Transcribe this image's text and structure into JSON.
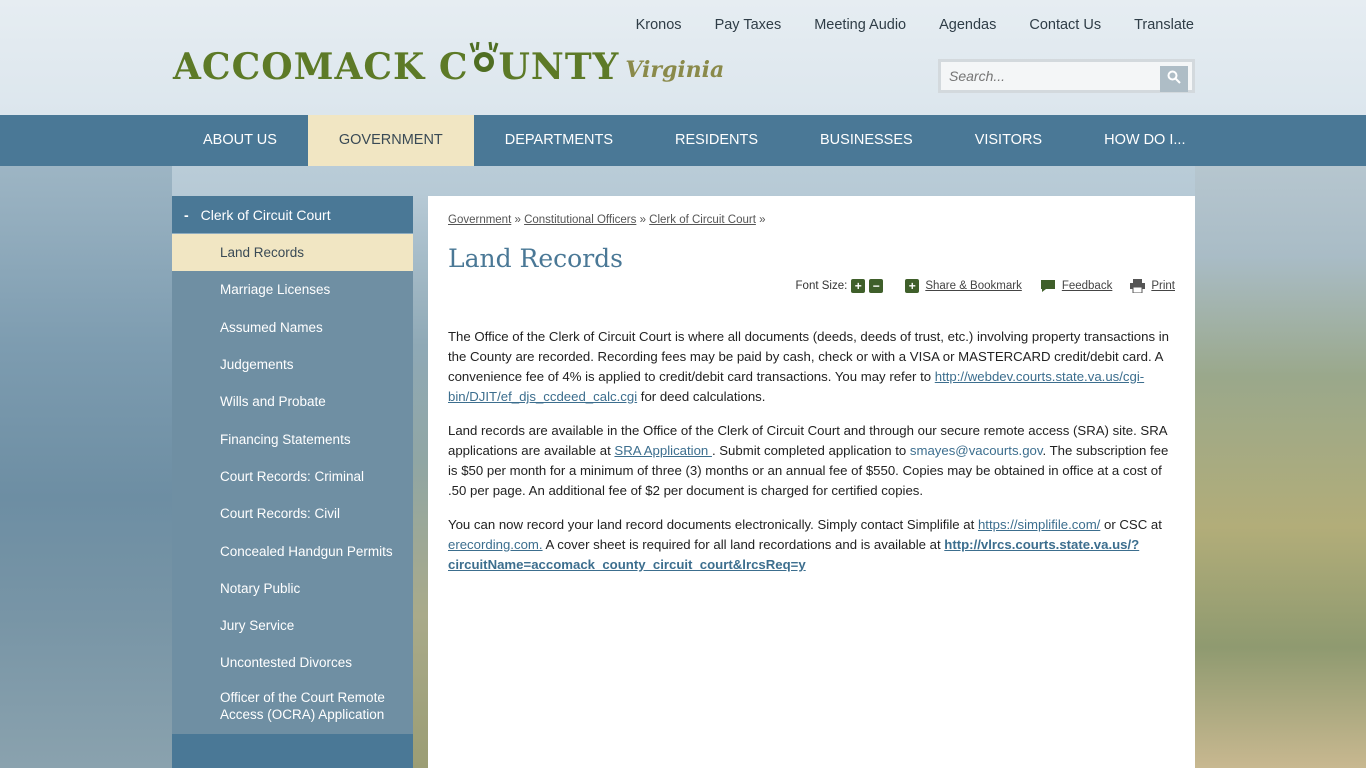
{
  "header": {
    "logo_main_1": "ACCOMACK C",
    "logo_main_2": "UNTY",
    "logo_sub": "Virginia",
    "top_links": [
      "Kronos",
      "Pay Taxes",
      "Meeting Audio",
      "Agendas",
      "Contact Us",
      "Translate"
    ],
    "search_placeholder": "Search..."
  },
  "nav": {
    "items": [
      "About Us",
      "Government",
      "Departments",
      "Residents",
      "Businesses",
      "Visitors",
      "How Do I..."
    ],
    "active": "Government"
  },
  "sidebar": {
    "heading": "Clerk of Circuit Court",
    "items": [
      "Land Records",
      "Marriage Licenses",
      "Assumed Names",
      "Judgements",
      "Wills and Probate",
      "Financing Statements",
      "Court Records: Criminal",
      "Court Records: Civil",
      "Concealed Handgun Permits",
      "Notary Public",
      "Jury Service",
      "Uncontested Divorces",
      "Officer of the Court Remote Access (OCRA) Application"
    ],
    "active": "Land Records"
  },
  "breadcrumb": [
    "Government",
    "Constitutional Officers",
    "Clerk of Circuit Court"
  ],
  "page_title": "Land Records",
  "tools": {
    "font_size_label": "Font Size:",
    "share": "Share & Bookmark",
    "feedback": "Feedback",
    "print": "Print"
  },
  "content": {
    "p1_text": "The Office of the Clerk of Circuit Court is where all documents (deeds, deeds of trust, etc.) involving property transactions in the County are recorded. Recording fees may be paid by cash, check or with a VISA or MASTERCARD credit/debit card. A convenience fee of 4% is applied to credit/debit card transactions. You may refer to ",
    "p1_link": "http://webdev.courts.state.va.us/cgi-bin/DJIT/ef_djs_ccdeed_calc.cgi",
    "p1_end": " for deed calculations.",
    "p2_text": "Land records are available in the Office of the Clerk of Circuit Court and through our secure remote access (SRA) site. SRA applications are available at ",
    "p2_link": "SRA Application ",
    "p2_mid": ".  Submit completed application to ",
    "p2_email": "smayes@vacourts.gov",
    "p2_end": ". The subscription fee is  $50 per month for a minimum of three (3) months or an annual fee of $550. Copies may be obtained in office at a cost of .50 per page. An additional fee of $2 per document is charged for certified copies.",
    "p3_text": "You can now record your land record documents electronically. Simply contact Simplifile at ",
    "p3_link1": "https://simplifile.com/",
    "p3_mid1": " or CSC at ",
    "p3_link2": "erecording.com.",
    "p3_mid2": "  A cover sheet is required for all land recordations and is available at ",
    "p3_link3": "http://vlrcs.courts.state.va.us/?circuitName=accomack_county_circuit_court&lrcsReq=y"
  },
  "colors": {
    "nav_blue": "#4a7896",
    "active_cream": "#f1e6c3",
    "logo_green": "#5d7a27"
  }
}
